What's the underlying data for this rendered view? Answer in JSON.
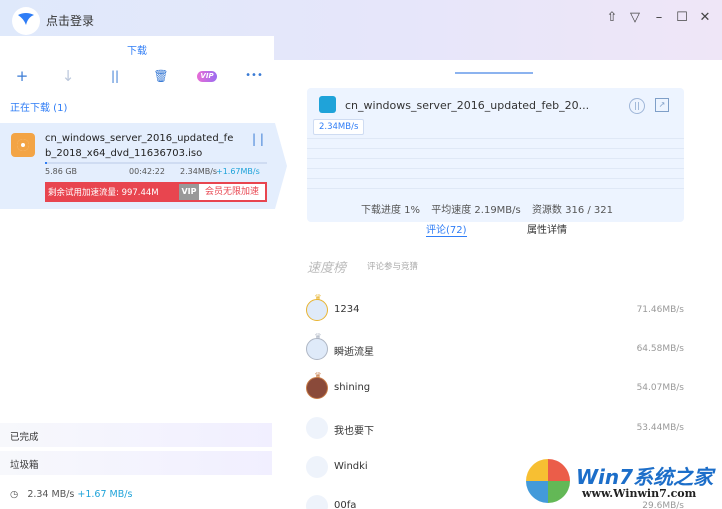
{
  "titlebar": {
    "login_label": "点击登录",
    "controls": {
      "skin": "⇧",
      "menu": "▽",
      "minimize": "–",
      "maximize": "☐",
      "close": "✕"
    }
  },
  "left_tabs": {
    "download_label": "下载"
  },
  "toolbar": {
    "add": "+",
    "download": "↓",
    "pause": "||",
    "delete": "🗑",
    "vip_label": "VIP",
    "more": "•••"
  },
  "section": {
    "downloading_label": "正在下载 (1)"
  },
  "task": {
    "file_name": "cn_windows_server_2016_updated_fe b_2018_x64_dvd_11636703.iso",
    "size": "5.86 GB",
    "eta": "00:42:22",
    "speed": "2.34MB/s",
    "bonus_speed": "+1.67MB/s",
    "progress_percent": 1,
    "trial_text": "剩余试用加速流量: 997.44M",
    "vip_tag": "VIP",
    "vip_button": "会员无限加速"
  },
  "bottom": {
    "completed_label": "已完成",
    "trash_label": "垃圾箱",
    "footer_speed": "2.34 MB/s",
    "footer_bonus": "+1.67 MB/s"
  },
  "detail": {
    "file_title": "cn_windows_server_2016_updated_feb_20...",
    "current_speed": "2.34MB/s",
    "progress_label": "下载进度 1%",
    "avg_speed_label": "平均速度 2.19MB/s",
    "sources_label": "资源数 316 / 321",
    "tab_comments": "评论(72)",
    "tab_properties": "属性详情"
  },
  "ranking": {
    "title": "速度榜",
    "subtitle": "评论参与竞猜",
    "peers": [
      {
        "name": "1234",
        "speed": "71.46MB/s",
        "badge": "1"
      },
      {
        "name": "瞬逝流星",
        "speed": "64.58MB/s",
        "badge": "2"
      },
      {
        "name": "shining",
        "speed": "54.07MB/s",
        "badge": "3"
      },
      {
        "name": "我也要下",
        "speed": "53.44MB/s"
      },
      {
        "name": "Windki",
        "speed": ""
      },
      {
        "name": "00fa",
        "speed": "29.6MB/s"
      }
    ]
  },
  "watermark": {
    "title": "Win7系统之家",
    "url": "www.Winwin7.com"
  }
}
